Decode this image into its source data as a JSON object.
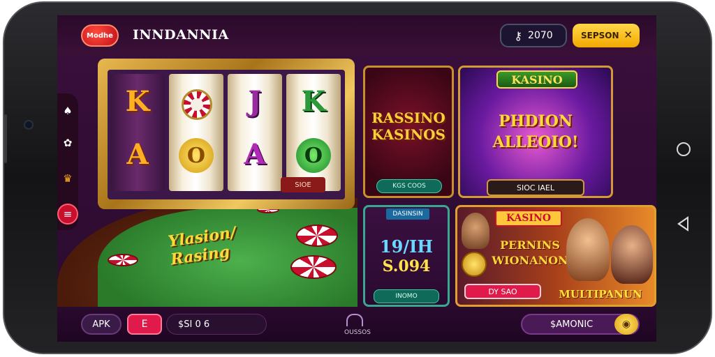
{
  "header": {
    "logo_text": "Modhe",
    "title": "INNDANNIA",
    "balance_value": "2070",
    "balance_icon": "key-icon",
    "action_label": "SEPSON",
    "close_glyph": "✕"
  },
  "sidebar": {
    "items": [
      {
        "icon": "spade-icon",
        "glyph": "♠"
      },
      {
        "icon": "gift-icon",
        "glyph": "✿"
      },
      {
        "icon": "crown-icon",
        "glyph": "♛"
      },
      {
        "icon": "menu-icon",
        "glyph": "≡"
      }
    ]
  },
  "slot": {
    "reels": [
      {
        "top": "K",
        "bottom": "A"
      },
      {
        "top": "chip",
        "bottom": "O"
      },
      {
        "top": "J",
        "bottom": "A"
      },
      {
        "top": "K",
        "bottom": "O"
      }
    ],
    "badge": "SIOE"
  },
  "cards": {
    "card_a": {
      "title": "RASSINO KASINOS",
      "button": "KGS COOS"
    },
    "card_b": {
      "tag": "KASINO",
      "title": "PHDION ALLEOIO!",
      "button": "SIOC IAEL"
    },
    "card_c": {
      "tag": "DASINSIN",
      "value_top": "19/IH",
      "value_bottom": "S.094",
      "button": "INOMO"
    },
    "card_d": {
      "tag": "KASINO",
      "title": "PERNINS WIONANON",
      "button": "DY SAO",
      "big_text": "MULTIPANUN"
    }
  },
  "table": {
    "felt_text": "Ylasion/ Rasing"
  },
  "footer": {
    "apk_label": "APK",
    "menu_glyph": "E",
    "balance_text": "$SI 0 6",
    "center_label": "OUSSOS",
    "right_label": "$AMONIC",
    "right_icon_glyph": "◉"
  }
}
